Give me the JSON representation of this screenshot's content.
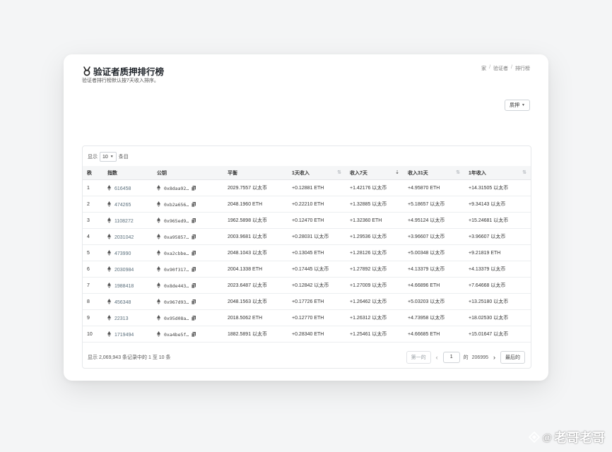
{
  "header": {
    "title": "验证者质押排行榜",
    "subtitle": "验证者排行榜默认按7天收入排序。",
    "breadcrumb": [
      "家",
      "验证者",
      "排行榜"
    ]
  },
  "toolbar": {
    "dropdown_label": "质押"
  },
  "table_controls": {
    "show_prefix": "显示",
    "entries_value": "10",
    "entries_suffix": "条目"
  },
  "table": {
    "columns": [
      "秩",
      "指数",
      "公钥",
      "平衡",
      "1天收入",
      "收入7天",
      "收入31天",
      "1年收入"
    ],
    "rows": [
      {
        "rank": "1",
        "index": "616458",
        "pubkey": "0x8daa92…",
        "balance": "2029.7557 以太币",
        "income_1d": "+0.12881 ETH",
        "income_7d": "+1.42176 以太币",
        "income_31d": "+4.95870 ETH",
        "income_1y": "+14.31505 以太币"
      },
      {
        "rank": "2",
        "index": "474265",
        "pubkey": "0xb2a656…",
        "balance": "2048.1960 ETH",
        "income_1d": "+0.22210 ETH",
        "income_7d": "+1.32885 以太币",
        "income_31d": "+5.18657 以太币",
        "income_1y": "+9.34143 以太币"
      },
      {
        "rank": "3",
        "index": "1108272",
        "pubkey": "0x965ed9…",
        "balance": "1962.5898 以太币",
        "income_1d": "+0.12470 ETH",
        "income_7d": "+1.32360 ETH",
        "income_31d": "+4.95124 以太币",
        "income_1y": "+15.24681 以太币"
      },
      {
        "rank": "4",
        "index": "2031042",
        "pubkey": "0xa95857…",
        "balance": "2003.9681 以太币",
        "income_1d": "+0.28031 以太币",
        "income_7d": "+1.29536 以太币",
        "income_31d": "+3.96607 以太币",
        "income_1y": "+3.96607 以太币"
      },
      {
        "rank": "5",
        "index": "473990",
        "pubkey": "0xa2cbbe…",
        "balance": "2048.1043 以太币",
        "income_1d": "+0.13045 ETH",
        "income_7d": "+1.28126 以太币",
        "income_31d": "+5.00348 以太币",
        "income_1y": "+9.21819 ETH"
      },
      {
        "rank": "6",
        "index": "2030984",
        "pubkey": "0x90f317…",
        "balance": "2004.1338 ETH",
        "income_1d": "+0.17445 以太币",
        "income_7d": "+1.27892 以太币",
        "income_31d": "+4.13379 以太币",
        "income_1y": "+4.13379 以太币"
      },
      {
        "rank": "7",
        "index": "1988418",
        "pubkey": "0x8de443…",
        "balance": "2023.6487 以太币",
        "income_1d": "+0.12842 以太币",
        "income_7d": "+1.27009 以太币",
        "income_31d": "+4.66896 ETH",
        "income_1y": "+7.64668 以太币"
      },
      {
        "rank": "8",
        "index": "456348",
        "pubkey": "0x967d93…",
        "balance": "2048.1563 以太币",
        "income_1d": "+0.17726 ETH",
        "income_7d": "+1.26462 以太币",
        "income_31d": "+5.03203 以太币",
        "income_1y": "+13.25180 以太币"
      },
      {
        "rank": "9",
        "index": "22313",
        "pubkey": "0x95d08a…",
        "balance": "2018.5062 ETH",
        "income_1d": "+0.12770 ETH",
        "income_7d": "+1.26312 以太币",
        "income_31d": "+4.73958 以太币",
        "income_1y": "+18.02530 以太币"
      },
      {
        "rank": "10",
        "index": "1719494",
        "pubkey": "0xa4be5f…",
        "balance": "1882.5891 以太币",
        "income_1d": "+0.28340 ETH",
        "income_7d": "+1.25461 以太币",
        "income_31d": "+4.66685 ETH",
        "income_1y": "+15.01647 以太币"
      }
    ]
  },
  "footer": {
    "info": "显示 2,069,943 条记录中的 1 至 10 条"
  },
  "pagination": {
    "first": "第一的",
    "page_value": "1",
    "of_label": "的",
    "total_pages": "206995",
    "last": "最后的"
  },
  "watermark": {
    "text": "老哥老哥",
    "at": "@"
  },
  "colors": {
    "accent": "#5b6f7c",
    "card_bg": "#ffffff",
    "page_bg": "#f4f5f6"
  },
  "icons": {
    "title": "medal-icon",
    "validator": "ethereum-icon",
    "copy": "copy-icon"
  }
}
